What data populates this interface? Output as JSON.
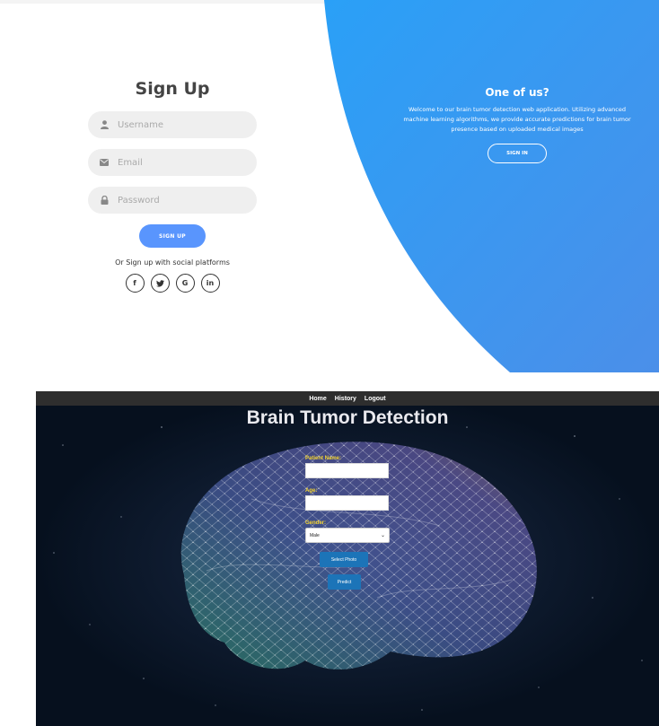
{
  "signup": {
    "title": "Sign Up",
    "username_placeholder": "Username",
    "email_placeholder": "Email",
    "password_placeholder": "Password",
    "button_label": "SIGN UP",
    "social_text": "Or Sign up with social platforms",
    "social": [
      {
        "label": "f",
        "icon": "facebook-icon"
      },
      {
        "label": "𝕨",
        "icon": "twitter-icon"
      },
      {
        "label": "G",
        "icon": "google-icon"
      },
      {
        "label": "in",
        "icon": "linkedin-icon"
      }
    ]
  },
  "panel": {
    "title": "One of us?",
    "text": "Welcome to our brain tumor detection web application. Utilizing advanced machine learning algorithms, we provide accurate predictions for brain tumor presence based on uploaded medical images",
    "button_label": "SIGN IN"
  },
  "nav": {
    "home": "Home",
    "history": "History",
    "logout": "Logout"
  },
  "detection": {
    "title": "Brain Tumor Detection",
    "patient_name_label": "Patient Name:",
    "age_label": "Age:",
    "gender_label": "Gender:",
    "gender_selected": "Male",
    "select_photo_label": "Select Photo",
    "predict_label": "Predict"
  },
  "colors": {
    "accent_blue": "#5995fd",
    "panel_blue_start": "#2a9cf6",
    "panel_blue_end": "#4a90e8",
    "label_yellow": "#f1d230",
    "button_blue": "#1c74b8",
    "navbar": "#2e2e2e"
  }
}
